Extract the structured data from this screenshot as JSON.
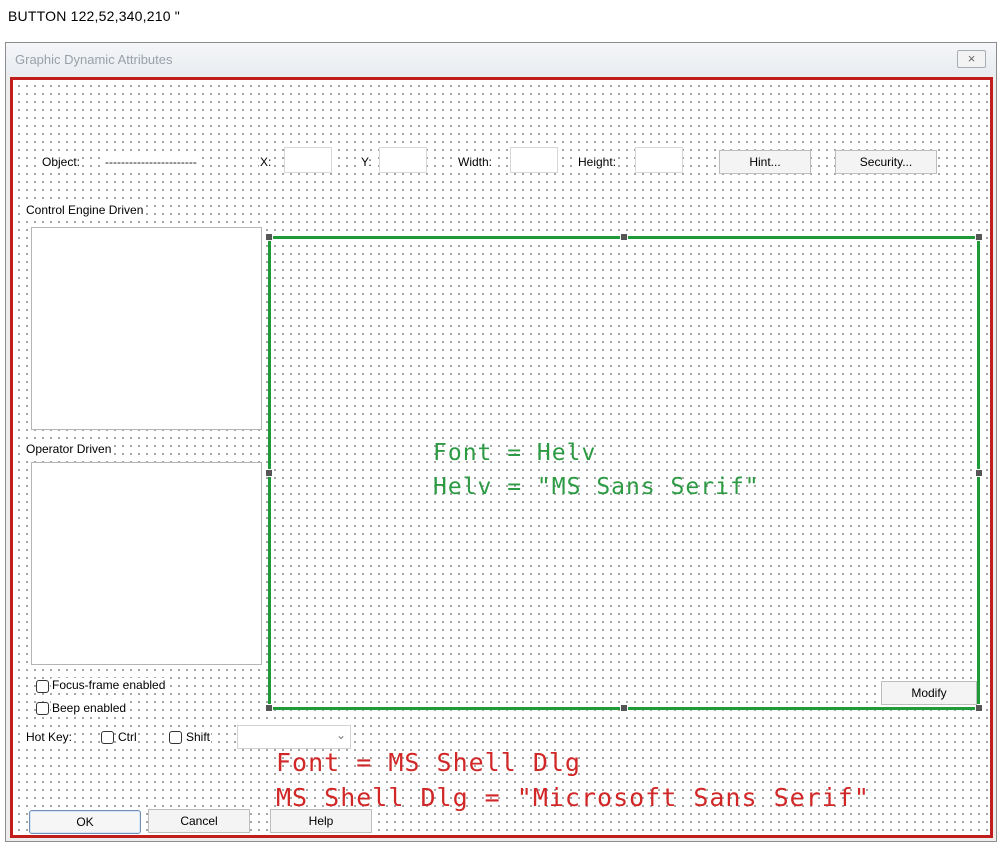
{
  "editor": {
    "status_line": "BUTTON  122,52,340,210  \""
  },
  "dialog": {
    "title": "Graphic Dynamic Attributes",
    "close_symbol": "×"
  },
  "top_row": {
    "object_label": "Object:",
    "object_value": "-----------------------",
    "x_label": "X:",
    "y_label": "Y:",
    "width_label": "Width:",
    "height_label": "Height:",
    "hint_button": "Hint...",
    "security_button": "Security..."
  },
  "sections": {
    "control_engine": "Control Engine Driven",
    "operator_driven": "Operator Driven"
  },
  "checkboxes": {
    "focus_frame": "Focus-frame enabled",
    "beep": "Beep enabled"
  },
  "hotkey": {
    "label": "Hot Key:",
    "ctrl": "Ctrl",
    "shift": "Shift",
    "dropdown_value": "",
    "dropdown_arrow": "⌄"
  },
  "buttons": {
    "modify": "Modify",
    "ok": "OK",
    "cancel": "Cancel",
    "help": "Help"
  },
  "annotations": {
    "green_line_1": "Font = Helv",
    "green_line_2": "Helv = \"MS Sans Serif\"",
    "red_line_1": "Font = MS Shell Dlg",
    "red_line_2": "MS Shell Dlg = \"Microsoft Sans Serif\""
  },
  "colors": {
    "dialog_outline": "#c21d1d",
    "frame_outline": "#1f9a3a",
    "green_annotation": "#2d9a44",
    "red_annotation": "#d12727"
  }
}
